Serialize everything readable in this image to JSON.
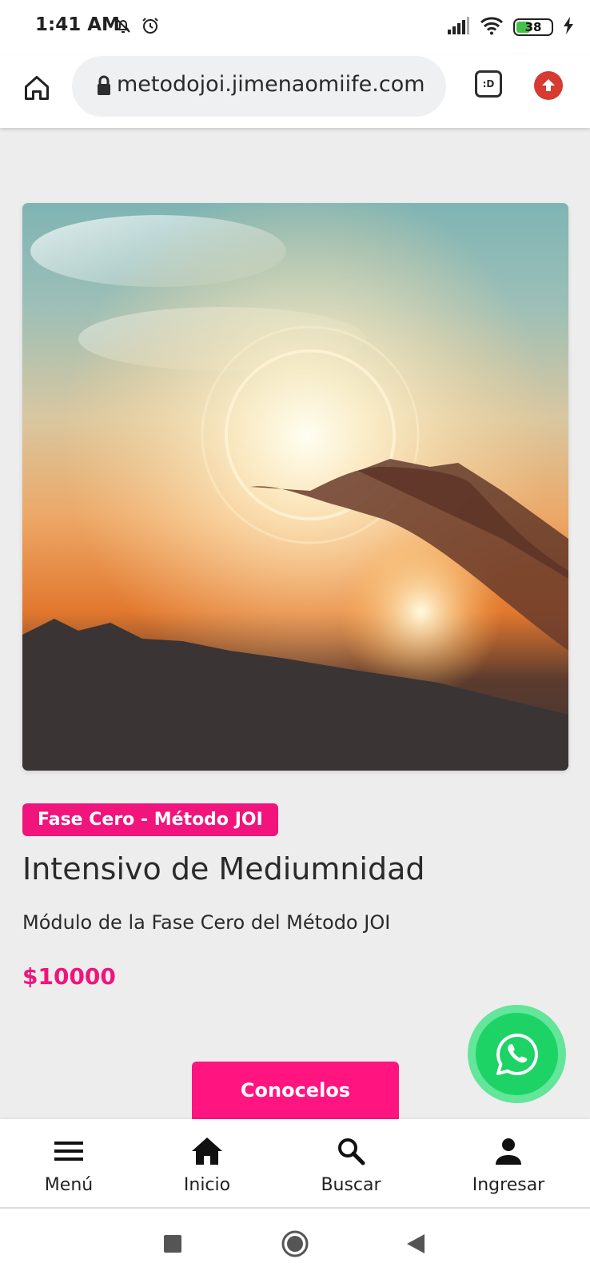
{
  "status_bar": {
    "time": "1:41 AM",
    "battery_level": "38",
    "icons_left": [
      "bell-off-icon",
      "alarm-icon"
    ],
    "icons_right": [
      "signal-icon",
      "wifi-icon",
      "battery-icon",
      "charging-icon"
    ]
  },
  "browser": {
    "url": "metodojoi.jimenaomiife.com",
    "tab_button_label": ":D",
    "icons": [
      "home-icon",
      "lock-icon",
      "tab-switcher-icon",
      "upload-icon"
    ]
  },
  "product": {
    "category": "Fase Cero - Método JOI",
    "title": "Intensivo de Mediumnidad",
    "subtitle": "Módulo de la Fase Cero del Método JOI",
    "price": "$10000",
    "cta_label": "Conocelos"
  },
  "bottom_nav": {
    "items": [
      {
        "label": "Menú",
        "icon": "menu-icon"
      },
      {
        "label": "Inicio",
        "icon": "home-filled-icon"
      },
      {
        "label": "Buscar",
        "icon": "search-icon"
      },
      {
        "label": "Ingresar",
        "icon": "user-icon"
      }
    ]
  },
  "colors": {
    "accent": "#f0147c",
    "whatsapp": "#1dd366",
    "background": "#ededed"
  }
}
